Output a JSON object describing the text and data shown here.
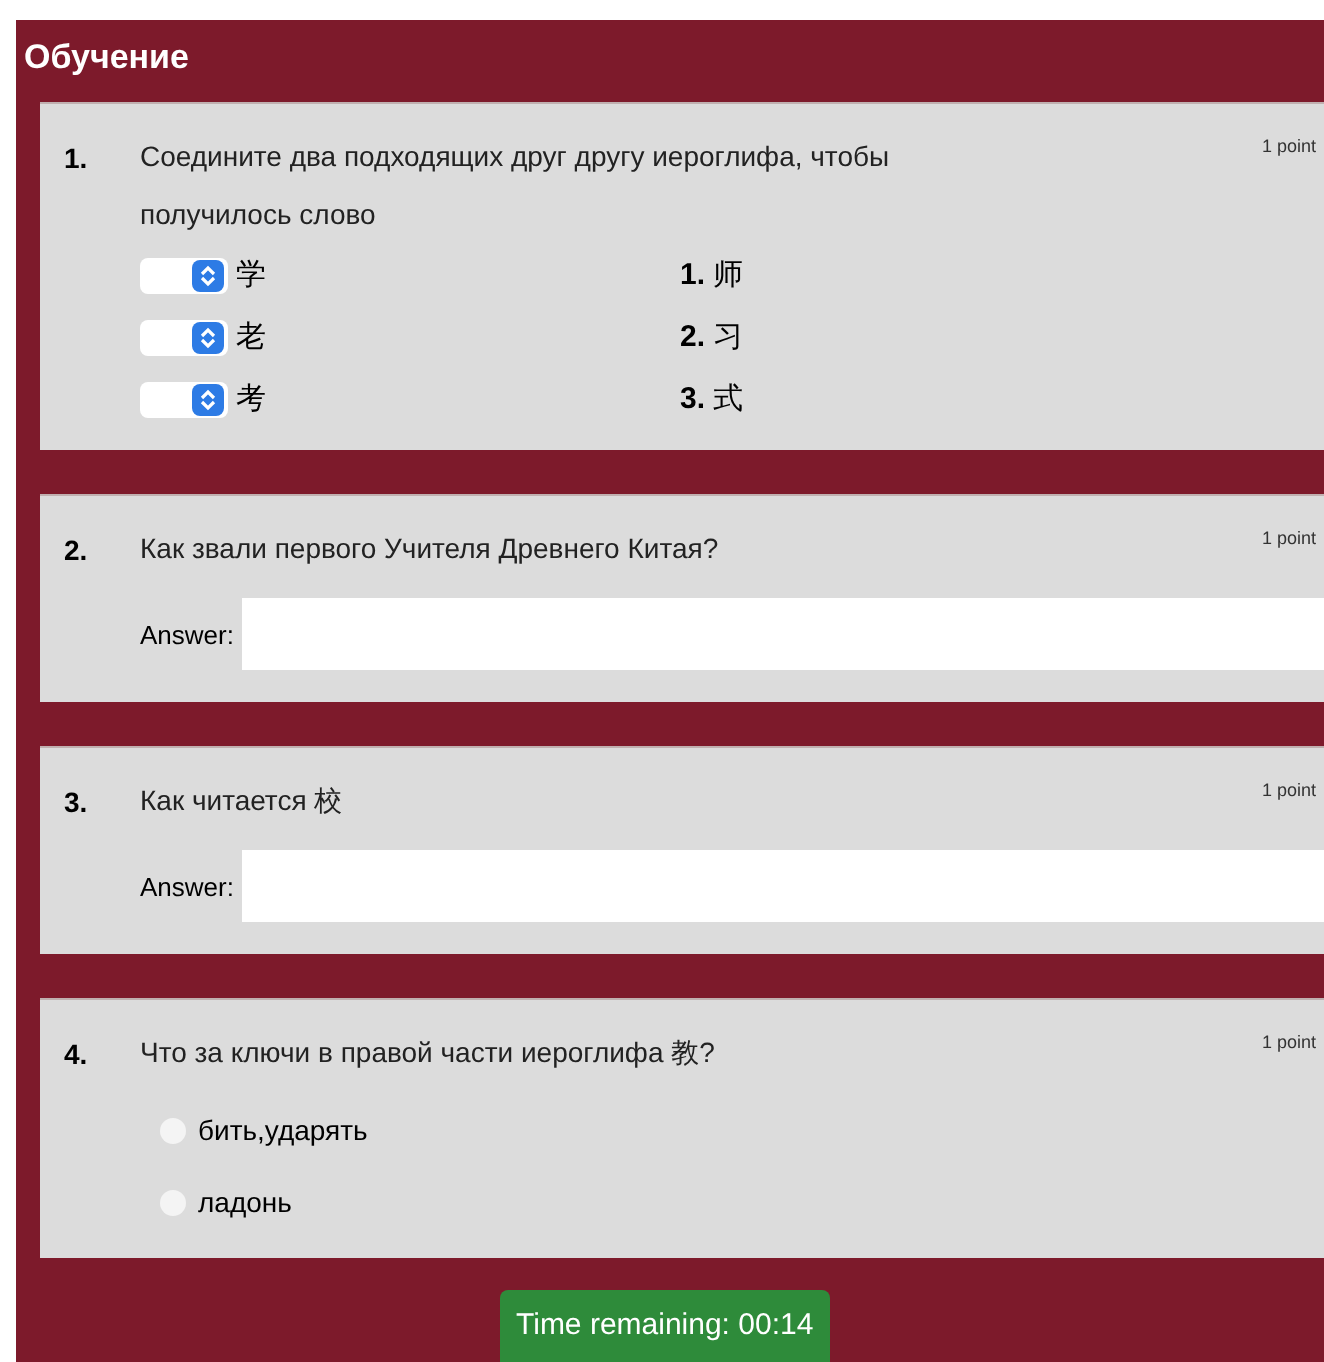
{
  "header": {
    "title": "Обучение"
  },
  "questions": [
    {
      "kind": "match",
      "number": "1.",
      "text": "Соедините два подходящих друг другу иероглифа, чтобы получилось слово",
      "points": "1 point",
      "left": [
        "学",
        "老",
        "考"
      ],
      "right": [
        {
          "number": "1.",
          "text": "师"
        },
        {
          "number": "2.",
          "text": "习"
        },
        {
          "number": "3.",
          "text": "式"
        }
      ]
    },
    {
      "kind": "answer",
      "number": "2.",
      "text": "Как звали первого Учителя Древнего Китая?",
      "points": "1 point",
      "answer_label": "Answer:"
    },
    {
      "kind": "answer",
      "number": "3.",
      "text": "Как читается 校",
      "points": "1 point",
      "answer_label": "Answer:"
    },
    {
      "kind": "choice",
      "number": "4.",
      "text": "Что за ключи в правой части иероглифа 教?",
      "points": "1 point",
      "options": [
        {
          "label": "бить,ударять",
          "selected": false
        },
        {
          "label": "ладонь",
          "selected": false
        }
      ]
    }
  ],
  "timer": {
    "text": "Time remaining: 00:14"
  }
}
